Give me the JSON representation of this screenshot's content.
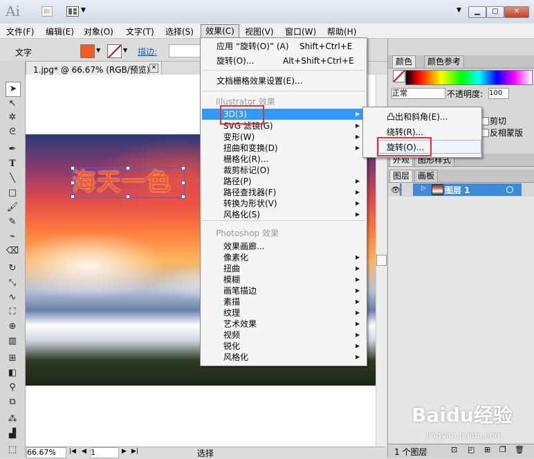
{
  "titlebar": {
    "app_logo": "Ai",
    "bridge_label": "Br"
  },
  "menubar": {
    "items": [
      "文件(F)",
      "编辑(E)",
      "对象(O)",
      "文字(T)",
      "选择(S)",
      "效果(C)",
      "视图(V)",
      "窗口(W)",
      "帮助(H)"
    ]
  },
  "controlbar": {
    "label": "文字",
    "stroke_label": "描边:"
  },
  "document": {
    "tab_label": "1.jpg* @ 66.67% (RGB/预览)",
    "art_text": "海天一色",
    "zoom": "66.67%",
    "page": "1",
    "status": "选择"
  },
  "effects_menu": {
    "apply_last": "应用 “旋转(O)” (A)",
    "apply_last_shortcut": "Shift+Ctrl+E",
    "last_effect": "旋转(O)...",
    "last_effect_shortcut": "Alt+Shift+Ctrl+E",
    "raster_settings": "文档栅格效果设置(E)...",
    "illustrator_header": "Illustrator 效果",
    "illustrator_items": [
      "3D(3)",
      "SVG 滤镜(G)",
      "变形(W)",
      "扭曲和变换(D)",
      "栅格化(R)...",
      "裁剪标记(O)",
      "路径(P)",
      "路径查找器(F)",
      "转换为形状(V)",
      "风格化(S)"
    ],
    "photoshop_header": "Photoshop 效果",
    "photoshop_items": [
      "效果画廊...",
      "像素化",
      "扭曲",
      "模糊",
      "画笔描边",
      "素描",
      "纹理",
      "艺术效果",
      "视频",
      "锐化",
      "风格化"
    ]
  },
  "submenu_3d": {
    "items": [
      "凸出和斜角(E)...",
      "绕转(R)...",
      "旋转(O)..."
    ]
  },
  "panels": {
    "color_tabs": [
      "颜色",
      "颜色参考"
    ],
    "blend_mode": "正常",
    "opacity_label": "不透明度:",
    "opacity_value": "100",
    "clip_label": "剪切",
    "invert_mask_label": "反相蒙版",
    "appearance_tabs": [
      "外观",
      "图形样式"
    ],
    "layers_tabs": [
      "图层",
      "画板"
    ],
    "layer_name": "图层 1",
    "layers_count": "1 个图层"
  },
  "watermark": {
    "main": "Baidu经验",
    "sub": "jingyan.baidu.com"
  },
  "colors": {
    "fill": "#f15a22",
    "highlight": "#3399ff",
    "callout": "#e03030"
  }
}
